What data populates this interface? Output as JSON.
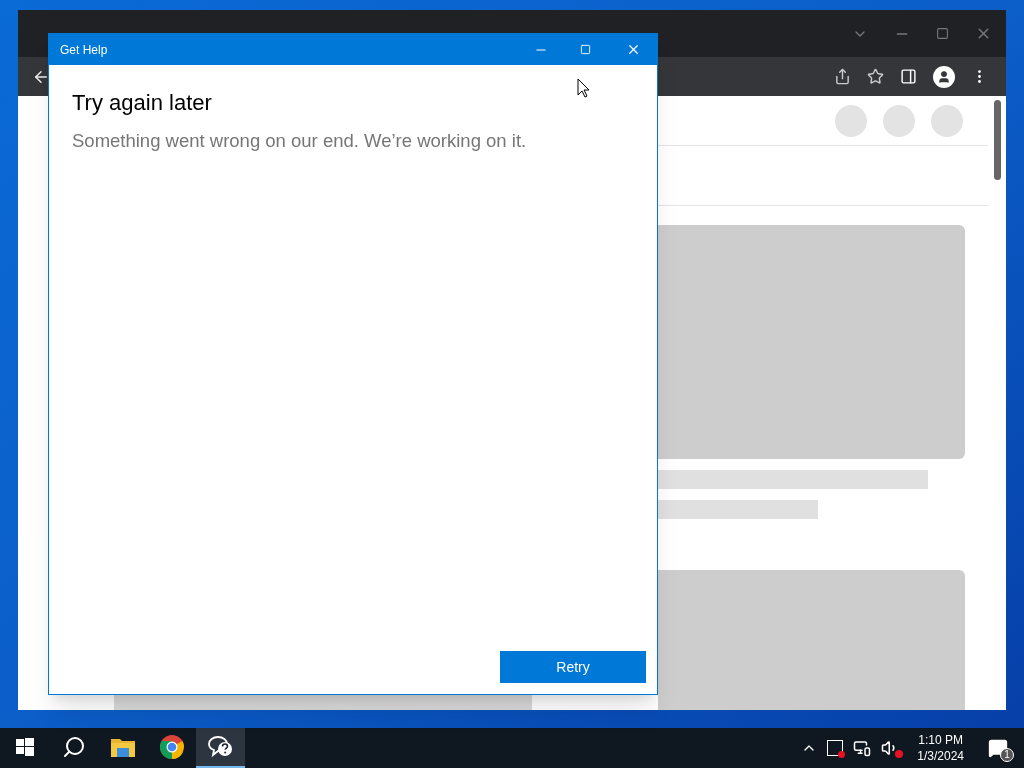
{
  "dialog": {
    "title": "Get Help",
    "heading": "Try again later",
    "message": "Something went wrong on our end. We’re working on it.",
    "button": "Retry"
  },
  "taskbar": {
    "apps": [
      {
        "kind": "start",
        "selected": false
      },
      {
        "kind": "search",
        "selected": false
      },
      {
        "kind": "files",
        "selected": false
      },
      {
        "kind": "browser",
        "selected": false
      },
      {
        "kind": "help",
        "selected": true
      }
    ],
    "clock": {
      "time": "1:10 PM",
      "date": "1/3/2024"
    },
    "notifications": "1"
  }
}
